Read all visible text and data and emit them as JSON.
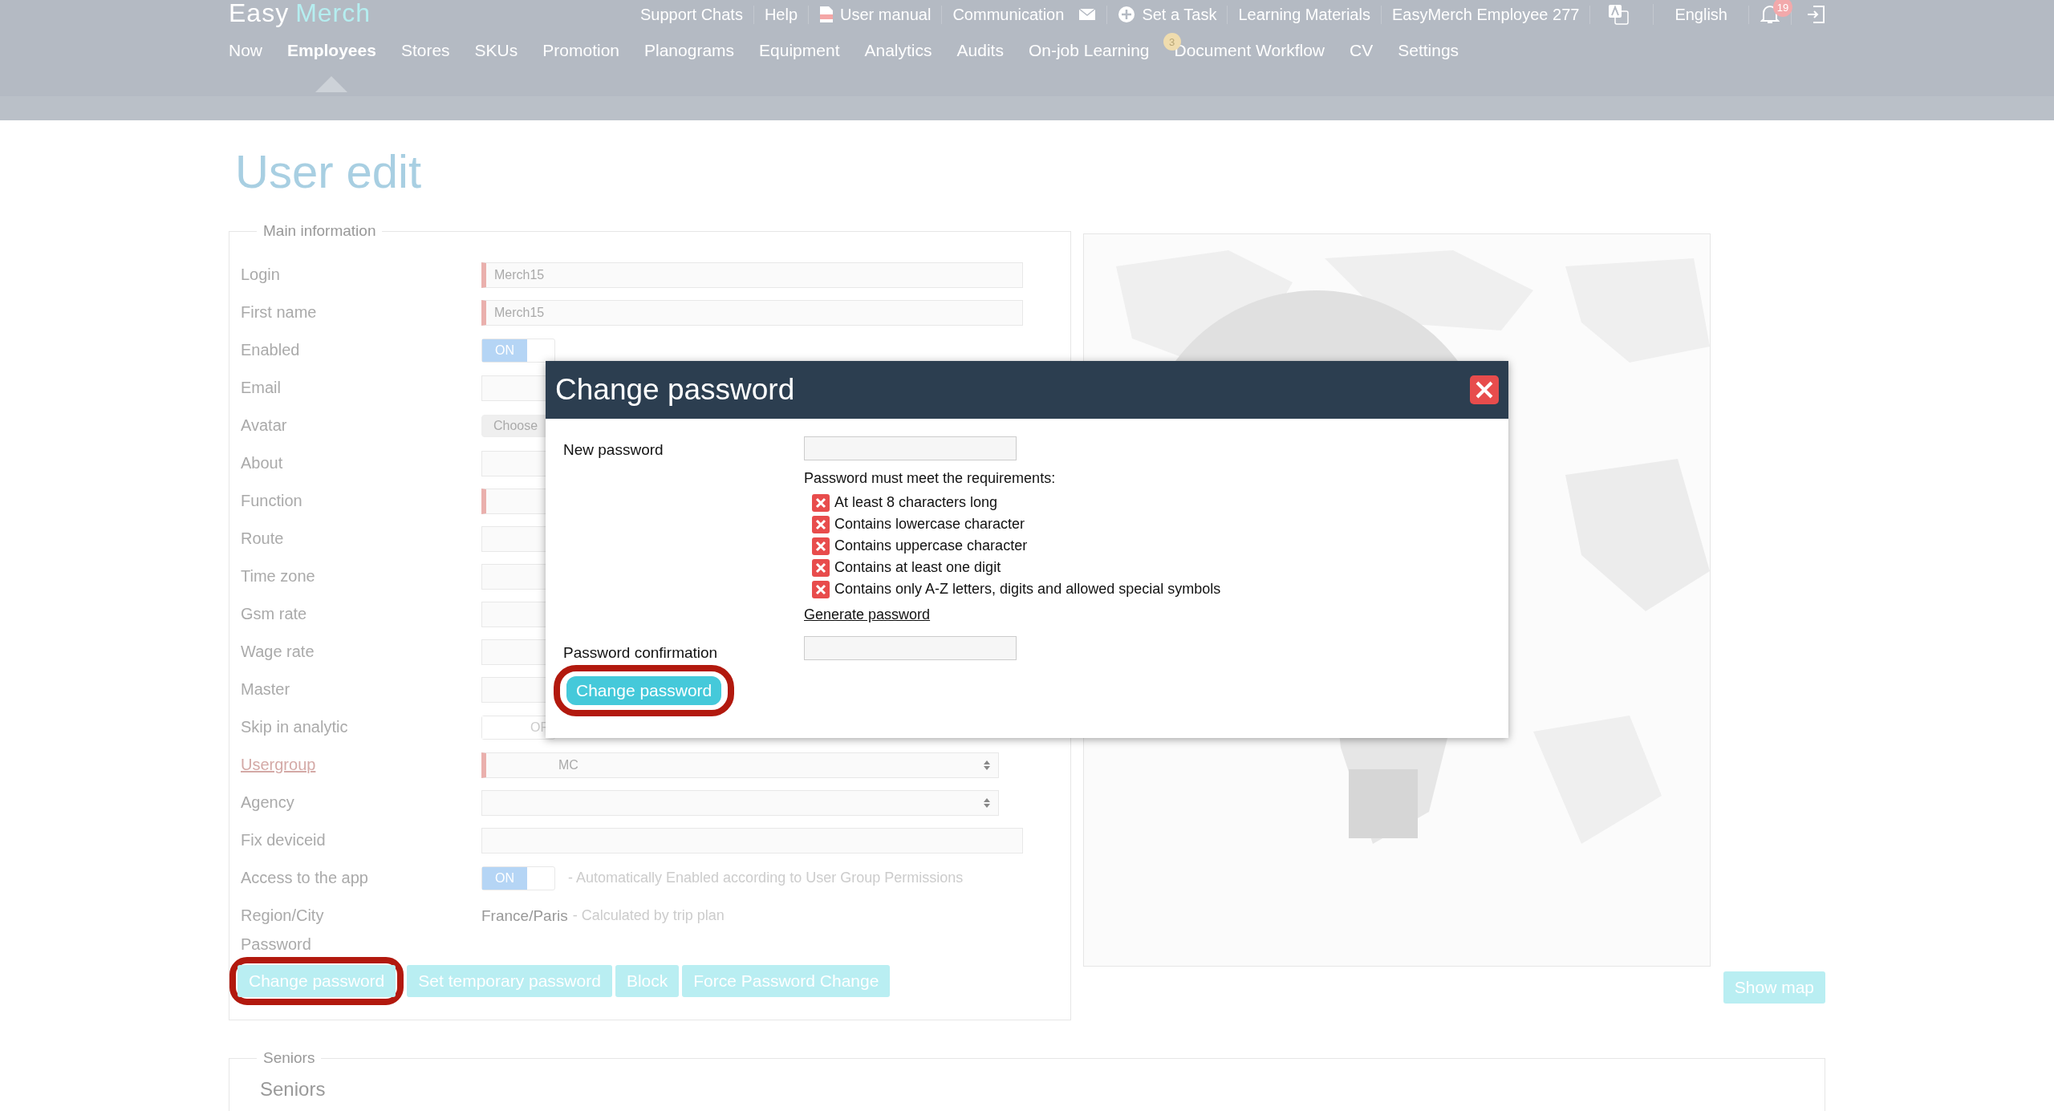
{
  "header": {
    "logo": {
      "first": "Easy",
      "second": "Merch"
    },
    "top_links": [
      {
        "label": "Support Chats"
      },
      {
        "label": "Help"
      },
      {
        "label": "User manual"
      },
      {
        "label": "Communication"
      },
      {
        "label": "Set a Task"
      },
      {
        "label": "Learning Materials"
      },
      {
        "label": "EasyMerch Employee 277"
      }
    ],
    "language": "English",
    "notifications_badge": "19",
    "nav": [
      {
        "label": "Now",
        "selected": false
      },
      {
        "label": "Employees",
        "selected": true
      },
      {
        "label": "Stores",
        "selected": false
      },
      {
        "label": "SKUs",
        "selected": false
      },
      {
        "label": "Promotion",
        "selected": false
      },
      {
        "label": "Planograms",
        "selected": false
      },
      {
        "label": "Equipment",
        "selected": false
      },
      {
        "label": "Analytics",
        "selected": false
      },
      {
        "label": "Audits",
        "selected": false
      },
      {
        "label": "On-job Learning",
        "selected": false
      },
      {
        "label": "Document Workflow",
        "selected": false,
        "badge": "3"
      },
      {
        "label": "CV",
        "selected": false
      },
      {
        "label": "Settings",
        "selected": false
      }
    ]
  },
  "page_title": "User edit",
  "main_info": {
    "legend": "Main information",
    "rows": [
      {
        "label": "Login",
        "kind": "text",
        "value": "Merch15",
        "required": true,
        "link": false
      },
      {
        "label": "First name",
        "kind": "text",
        "value": "Merch15",
        "required": true,
        "link": false
      },
      {
        "label": "Enabled",
        "kind": "toggle",
        "value": "ON",
        "on": true,
        "link": false
      },
      {
        "label": "Email",
        "kind": "text",
        "required": false,
        "link": false
      },
      {
        "label": "Avatar",
        "kind": "file",
        "value": "Choose",
        "link": false
      },
      {
        "label": "About",
        "kind": "text",
        "required": false,
        "link": false
      },
      {
        "label": "Function",
        "kind": "select",
        "required": true,
        "link": false
      },
      {
        "label": "Route",
        "kind": "text",
        "required": false,
        "link": false
      },
      {
        "label": "Time zone",
        "kind": "select",
        "required": false,
        "link": false
      },
      {
        "label": "Gsm rate",
        "kind": "text",
        "required": false,
        "link": false
      },
      {
        "label": "Wage rate",
        "kind": "text",
        "required": false,
        "link": false
      },
      {
        "label": "Master",
        "kind": "select",
        "required": false,
        "link": false
      },
      {
        "label": "Skip in analytic",
        "kind": "toggle",
        "value": "OF",
        "on": false,
        "link": false
      },
      {
        "label": "Usergroup",
        "kind": "select",
        "value": "MC",
        "required": true,
        "link": true
      },
      {
        "label": "Agency",
        "kind": "select",
        "required": false,
        "link": false
      },
      {
        "label": "Fix deviceid",
        "kind": "text",
        "required": false,
        "link": false
      },
      {
        "label": "Access to the app",
        "kind": "toggle",
        "value": "ON",
        "on": true,
        "note": "- Automatically Enabled according to User Group Permissions",
        "link": false
      },
      {
        "label": "Region/City",
        "kind": "static",
        "value": "France/Paris",
        "note": "- Calculated by trip plan",
        "link": false
      },
      {
        "label": "Password",
        "kind": "label",
        "link": false
      }
    ],
    "buttons": [
      {
        "label": "Change password",
        "highlighted": true
      },
      {
        "label": "Set temporary password",
        "highlighted": false
      },
      {
        "label": "Block",
        "highlighted": false
      },
      {
        "label": "Force Password Change",
        "highlighted": false
      }
    ]
  },
  "map": {
    "kind": "picture",
    "button": "Show map"
  },
  "seniors": {
    "legend": "Seniors",
    "heading": "Seniors"
  },
  "modal": {
    "title": "Change password",
    "new_password_label": "New password",
    "requirements_title": "Password must meet the requirements:",
    "requirements": [
      {
        "text": "At least 8 characters long",
        "met": false
      },
      {
        "text": "Contains lowercase character",
        "met": false
      },
      {
        "text": "Contains uppercase character",
        "met": false
      },
      {
        "text": "Contains at least one digit",
        "met": false
      },
      {
        "text": "Contains only A-Z letters, digits and allowed special symbols",
        "met": false
      }
    ],
    "generate_link": "Generate password",
    "confirmation_label": "Password confirmation",
    "button": {
      "label": "Change password",
      "highlighted": true
    }
  }
}
